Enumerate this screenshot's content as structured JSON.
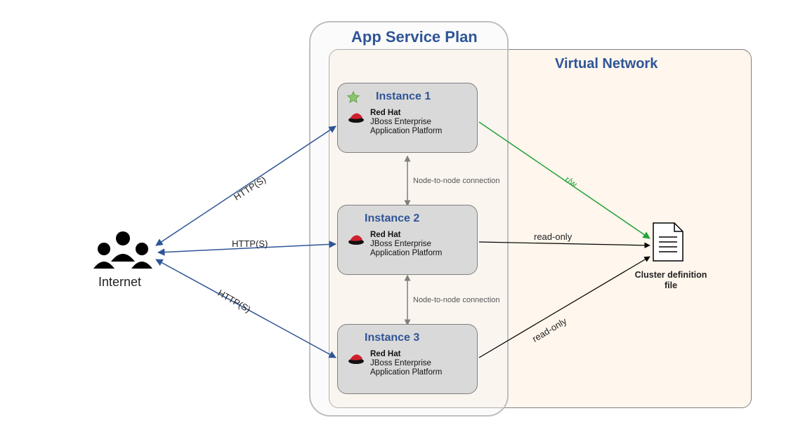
{
  "titles": {
    "app_service_plan": "App Service Plan",
    "virtual_network": "Virtual Network"
  },
  "internet_label": "Internet",
  "http_labels": {
    "top": "HTTP(S)",
    "mid": "HTTP(S)",
    "bot": "HTTP(S)"
  },
  "node_conn": {
    "top": "Node-to-node connection",
    "bot": "Node-to-node connection"
  },
  "file": {
    "label_l1": "Cluster definition",
    "label_l2": "file"
  },
  "access": {
    "rw": "r/w",
    "ro_mid": "read-only",
    "ro_bot": "read-only"
  },
  "instances": [
    {
      "title": "Instance 1",
      "rh_name": "Red Hat",
      "rh_line2": "JBoss Enterprise",
      "rh_line3": "Application Platform"
    },
    {
      "title": "Instance 2",
      "rh_name": "Red Hat",
      "rh_line2": "JBoss Enterprise",
      "rh_line3": "Application Platform"
    },
    {
      "title": "Instance 3",
      "rh_name": "Red Hat",
      "rh_line2": "JBoss Enterprise",
      "rh_line3": "Application Platform"
    }
  ]
}
